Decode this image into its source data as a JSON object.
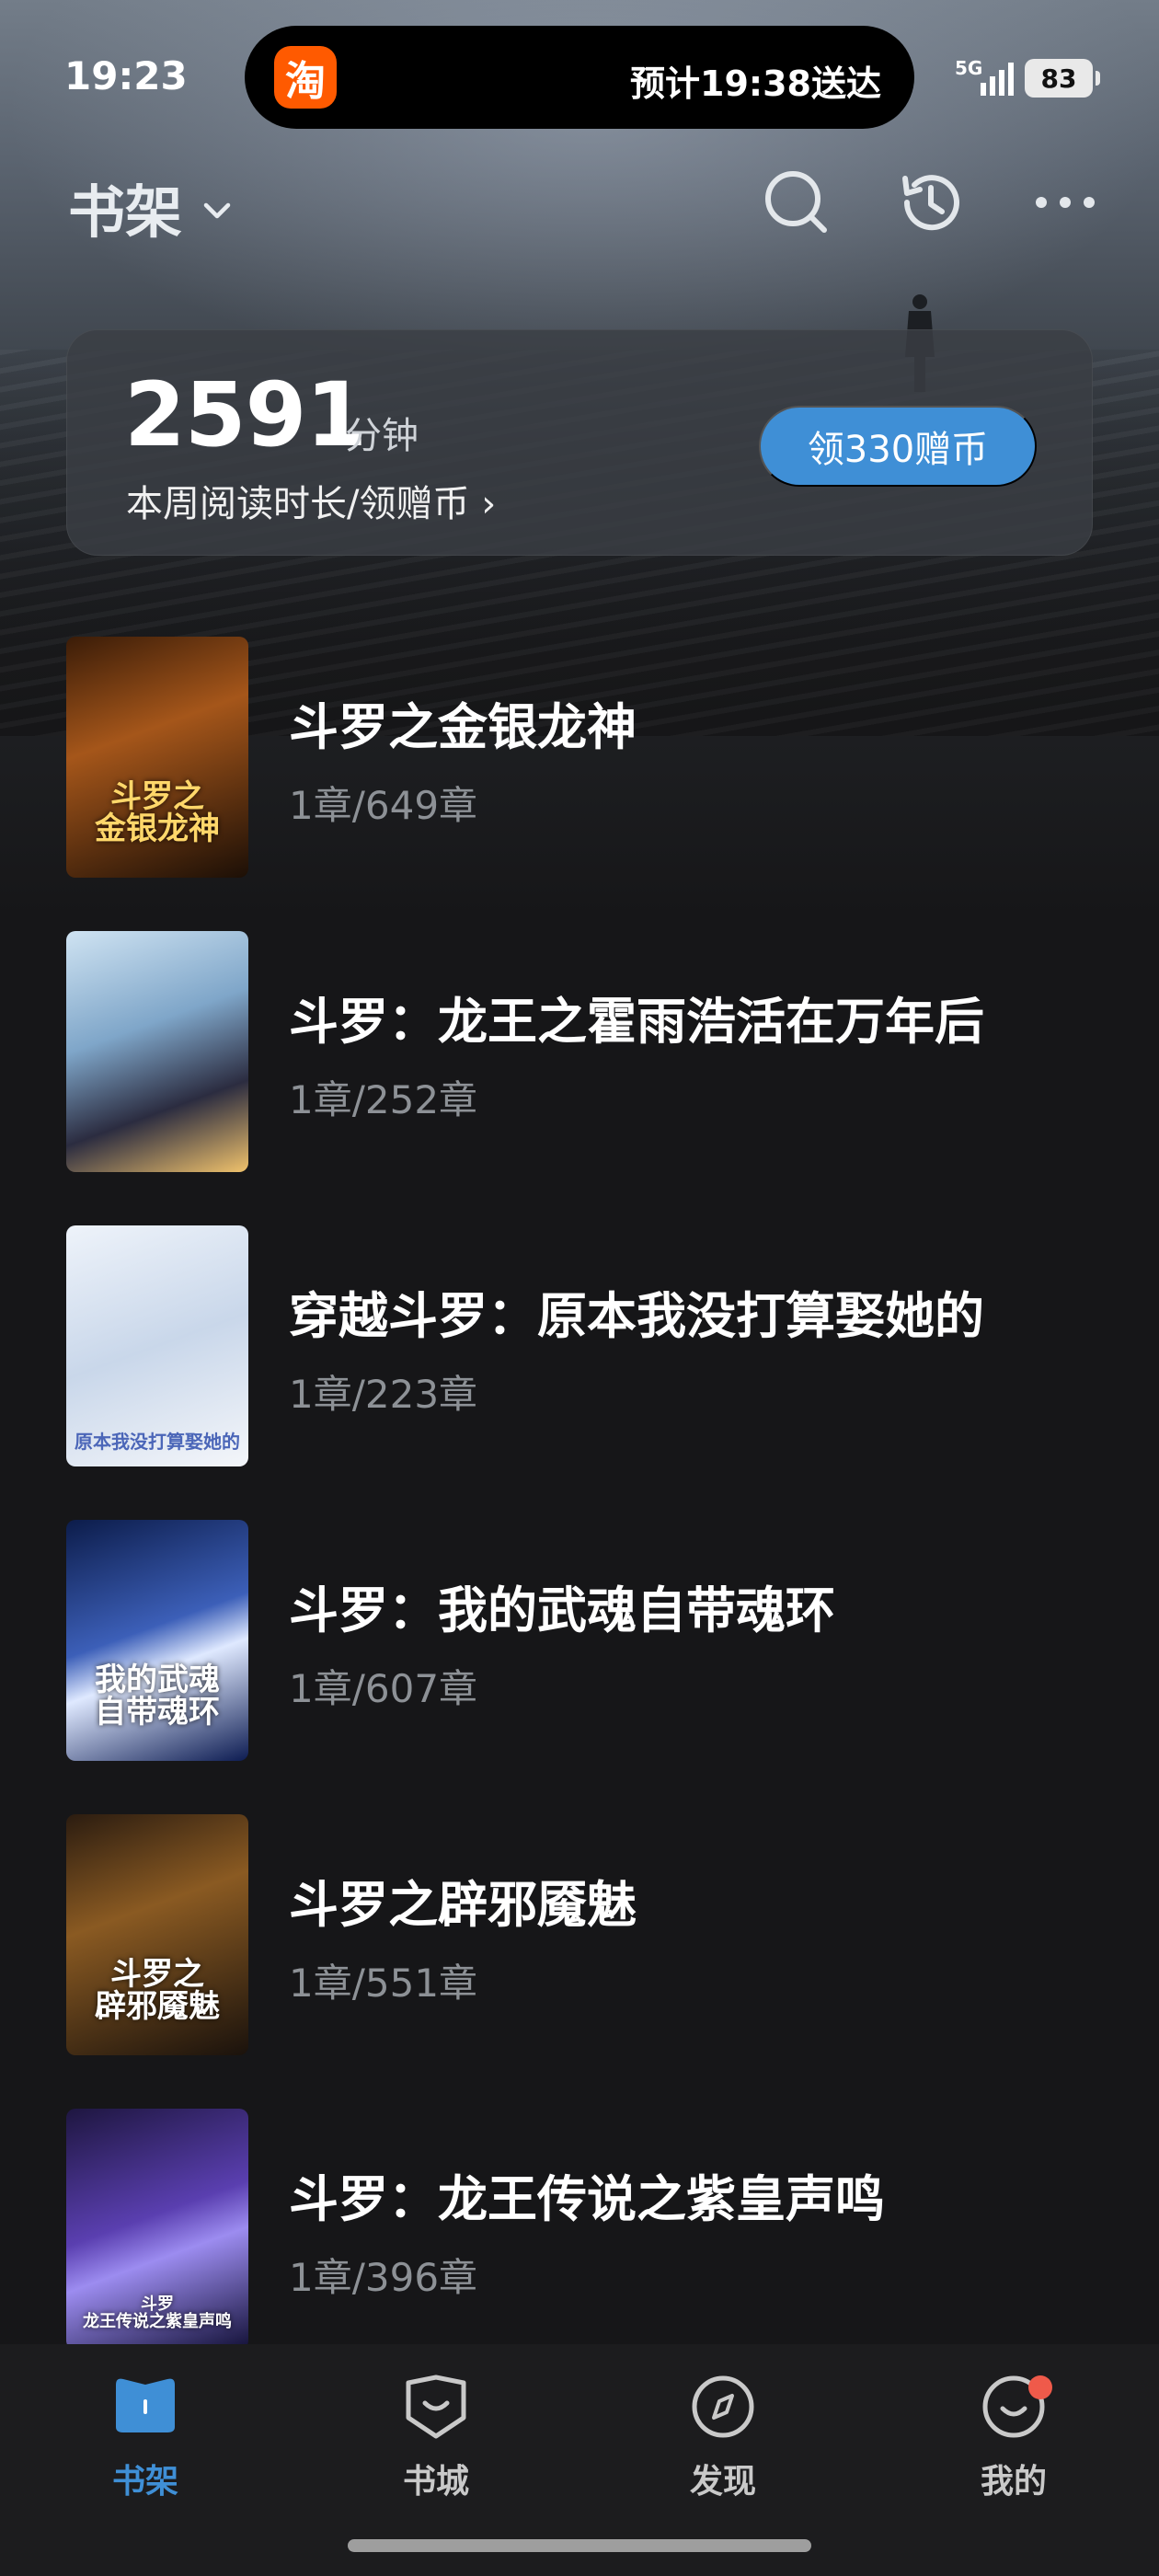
{
  "status_bar": {
    "time": "19:23",
    "notification_app_icon": "淘",
    "notification_text": "预计19:38送达",
    "network": "5G",
    "battery": "83"
  },
  "header": {
    "title": "书架"
  },
  "reading_card": {
    "minutes": "2591",
    "unit": "分钟",
    "link_label": "本周阅读时长/领赠币 ›",
    "claim_button": "领330赠币"
  },
  "books": [
    {
      "title": "斗罗之金银龙神",
      "progress": "1章/649章",
      "cover_text": "斗罗之\n金银龙神"
    },
    {
      "title": "斗罗：龙王之霍雨浩活在万年后",
      "progress": "1章/252章",
      "cover_text": ""
    },
    {
      "title": "穿越斗罗：原本我没打算娶她的",
      "progress": "1章/223章",
      "cover_text": "原本我没打算娶她的"
    },
    {
      "title": "斗罗：我的武魂自带魂环",
      "progress": "1章/607章",
      "cover_text": "我的武魂\n自带魂环"
    },
    {
      "title": "斗罗之辟邪魇魅",
      "progress": "1章/551章",
      "cover_text": "斗罗之\n辟邪魇魅"
    },
    {
      "title": "斗罗：龙王传说之紫皇声鸣",
      "progress": "1章/396章",
      "cover_text": "斗罗\n龙王传说之紫皇声鸣"
    }
  ],
  "bottom_nav": {
    "items": [
      {
        "label": "书架",
        "icon": "bookshelf-icon",
        "active": true
      },
      {
        "label": "书城",
        "icon": "bookstore-icon",
        "active": false
      },
      {
        "label": "发现",
        "icon": "compass-icon",
        "active": false
      },
      {
        "label": "我的",
        "icon": "profile-icon",
        "active": false,
        "badge": true
      }
    ]
  },
  "colors": {
    "accent": "#3f8fd6",
    "background": "#161618",
    "badge": "#ef5a4a"
  }
}
